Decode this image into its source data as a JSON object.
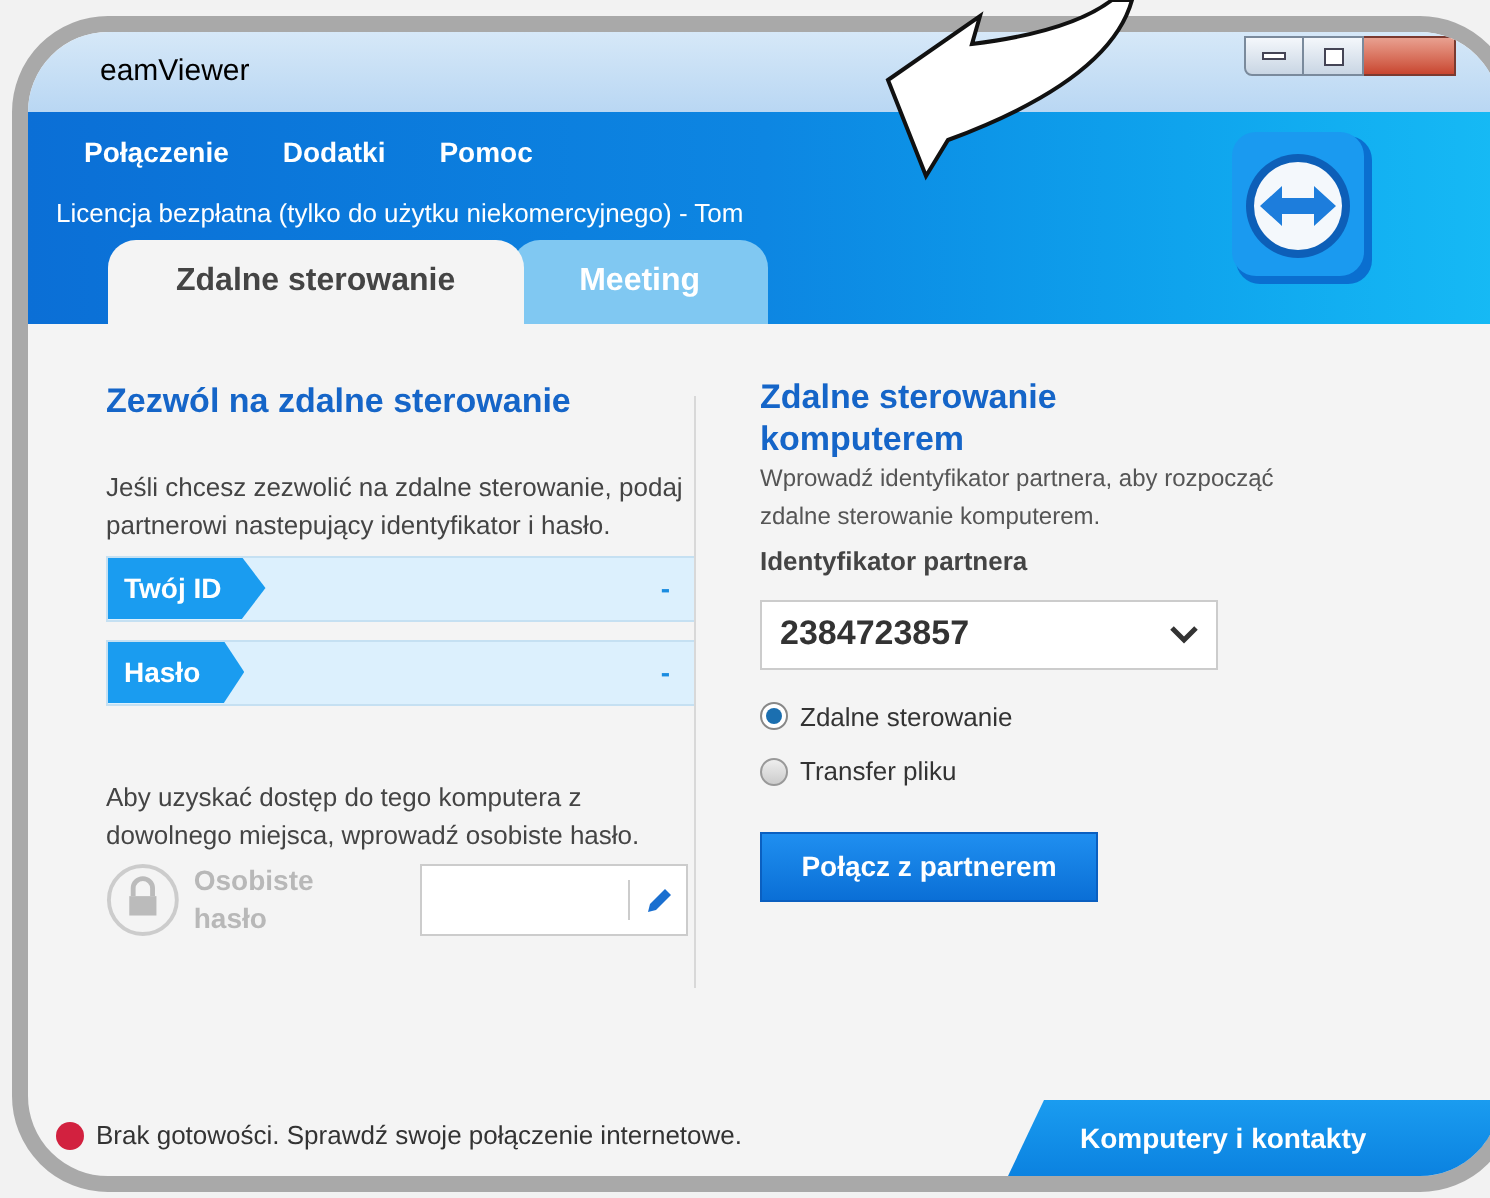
{
  "window": {
    "title": "eamViewer"
  },
  "menu": [
    "Połączenie",
    "Dodatki",
    "Pomoc"
  ],
  "license": "Licencja bezpłatna (tylko do użytku niekomercyjnego) - Tom",
  "tabs": [
    {
      "label": "Zdalne sterowanie",
      "selected": true
    },
    {
      "label": "Meeting",
      "selected": false
    }
  ],
  "allow": {
    "heading": "Zezwól na zdalne sterowanie",
    "description": "Jeśli chcesz zezwolić na zdalne sterowanie, podaj partnerowi nastepujący identyfikator i hasło.",
    "fields": [
      {
        "label": "Twój ID",
        "value": "-"
      },
      {
        "label": "Hasło",
        "value": "-"
      }
    ],
    "personal_note": "Aby uzyskać dostęp do tego komputera z dowolnego miejsca, wprowadź osobiste hasło.",
    "personal_label": "Osobiste hasło"
  },
  "control": {
    "heading": "Zdalne sterowanie komputerem",
    "description": "Wprowadź identyfikator partnera, aby rozpocząć zdalne sterowanie komputerem.",
    "partner_label": "Identyfikator partnera",
    "partner_id": "2384723857",
    "modes": [
      {
        "label": "Zdalne sterowanie",
        "selected": true
      },
      {
        "label": "Transfer pliku",
        "selected": false
      }
    ],
    "button": "Połącz z partnerem"
  },
  "status": {
    "text": "Brak gotowości. Sprawdź swoje połączenie internetowe."
  },
  "contacts_tab": "Komputery i kontakty"
}
